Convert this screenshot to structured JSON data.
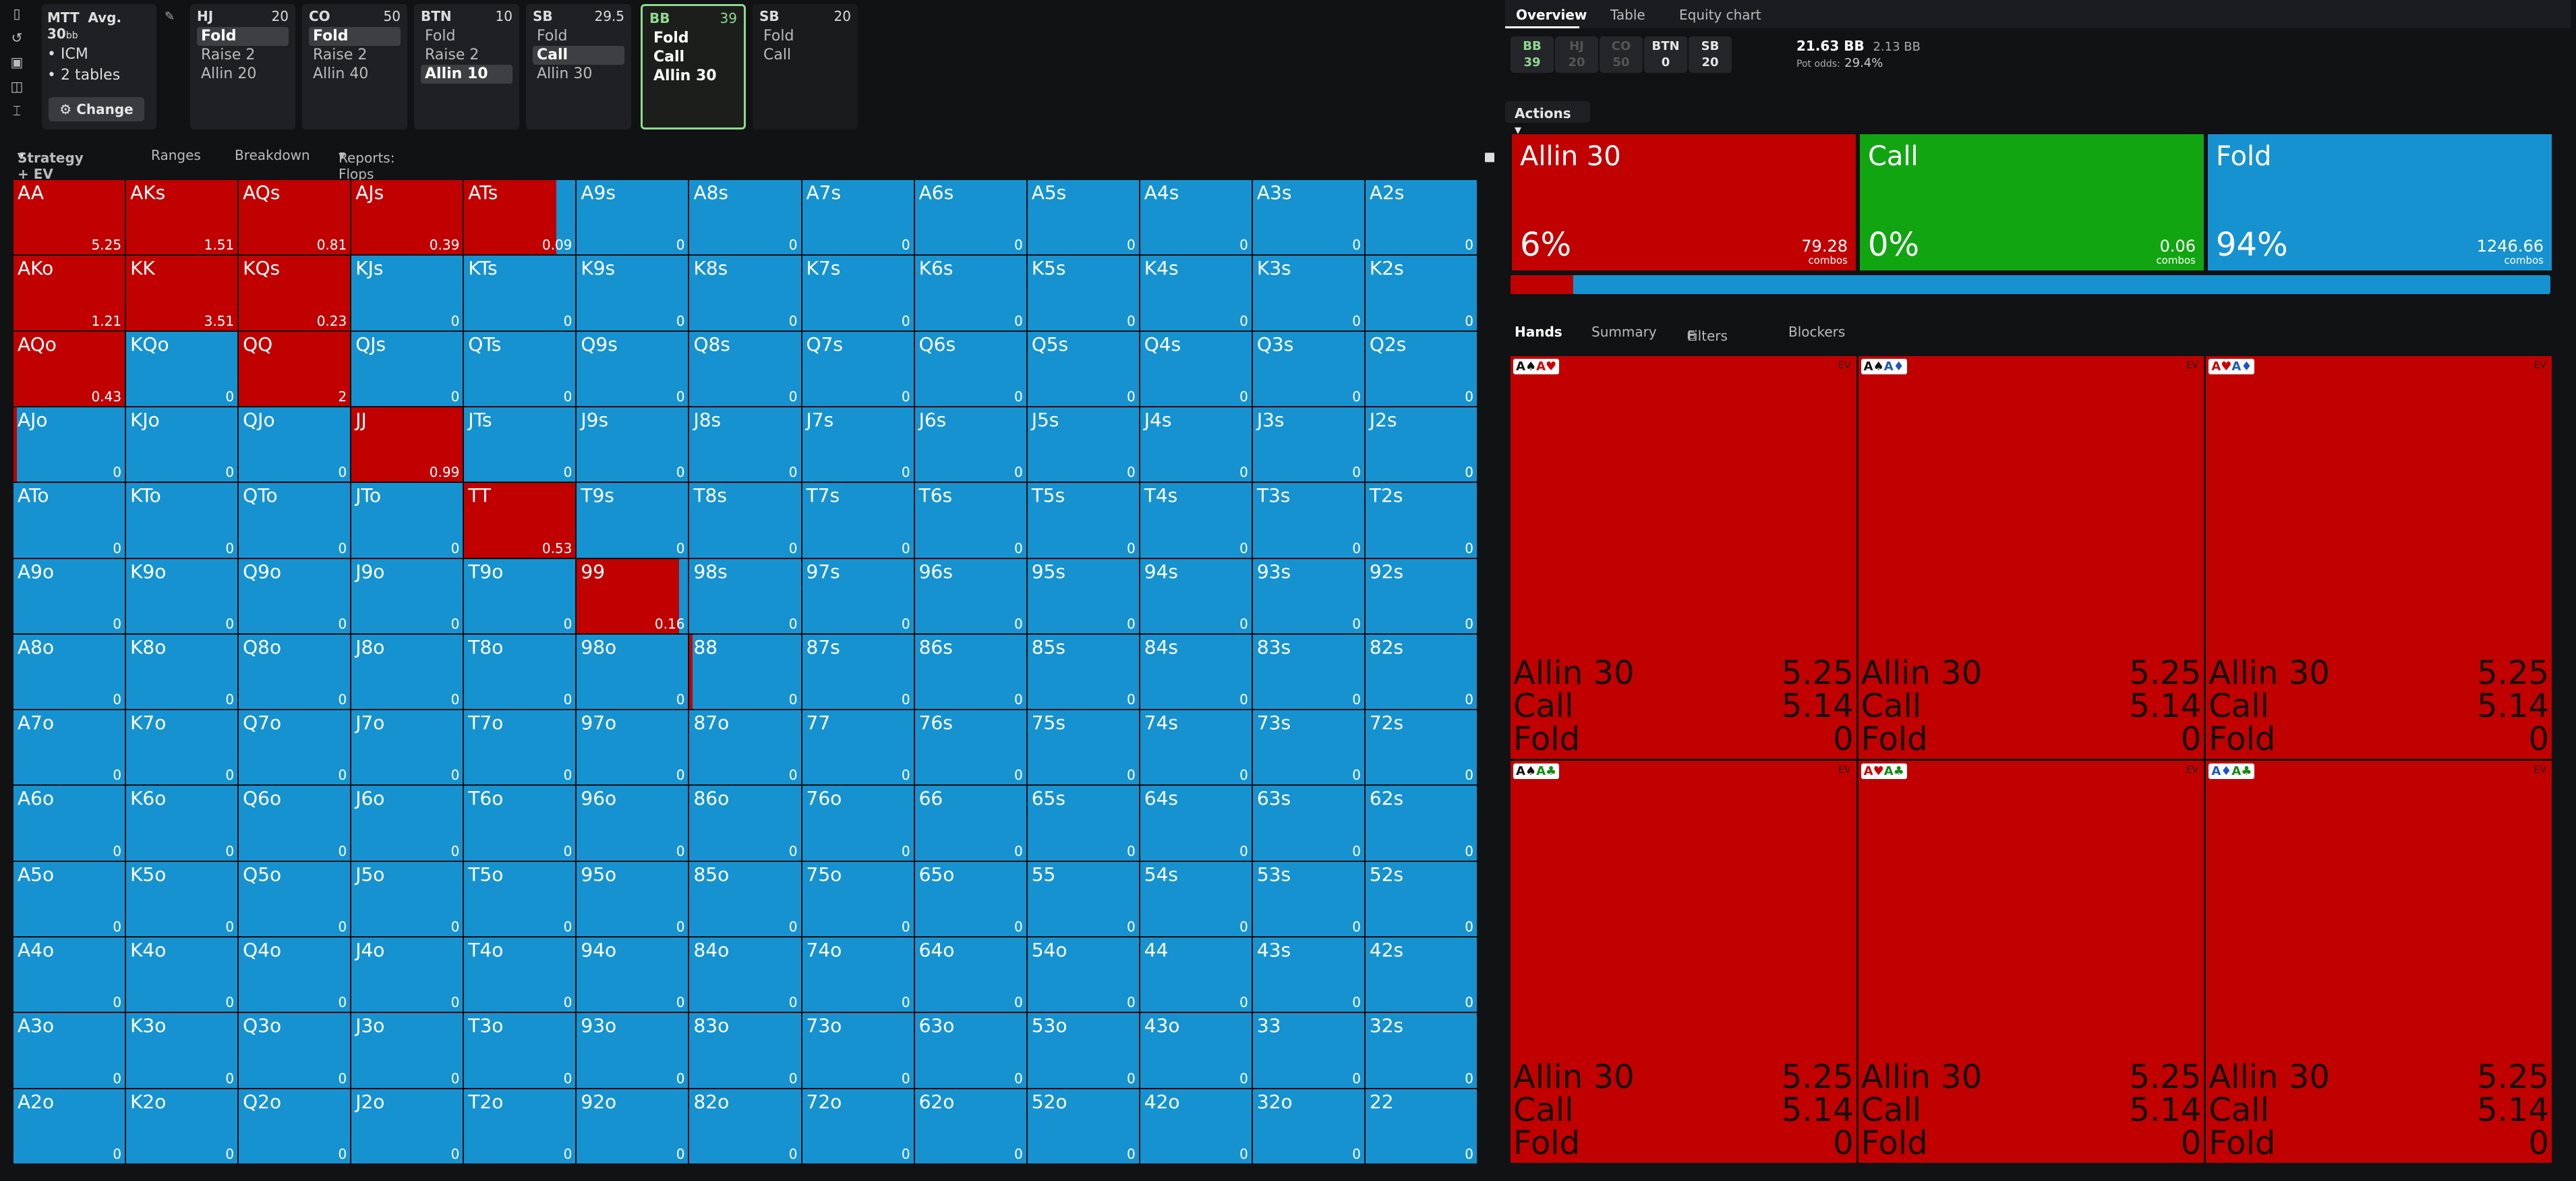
{
  "header": {
    "mtt_title": "MTT",
    "mtt_avg": "Avg. 30",
    "mtt_avg_unit": "bb",
    "mtt_items": [
      "ICM",
      "2 tables"
    ],
    "change_label": "Change",
    "positions": [
      {
        "name": "HJ",
        "stack": "20",
        "actions": [
          "Fold",
          "Raise 2",
          "Allin 20"
        ],
        "selected": 0
      },
      {
        "name": "CO",
        "stack": "50",
        "actions": [
          "Fold",
          "Raise 2",
          "Allin 40"
        ],
        "selected": 0
      },
      {
        "name": "BTN",
        "stack": "10",
        "actions": [
          "Fold",
          "Raise 2",
          "Allin 10"
        ],
        "selected": 2
      },
      {
        "name": "SB",
        "stack": "29.5",
        "actions": [
          "Fold",
          "Call",
          "Allin 30"
        ],
        "selected": 1
      },
      {
        "name": "BB",
        "stack": "39",
        "actions": [
          "Fold",
          "Call",
          "Allin 30"
        ],
        "selected": -1
      },
      {
        "name": "SB",
        "stack": "20",
        "actions": [
          "Fold",
          "Call"
        ],
        "selected": -1
      }
    ]
  },
  "left_tabs": {
    "strategy": "Strategy + EV",
    "ranges": "Ranges",
    "breakdown": "Breakdown",
    "reports": "Reports: Flops"
  },
  "grid": {
    "hands": [
      [
        "AA",
        "AKs",
        "AQs",
        "AJs",
        "ATs",
        "A9s",
        "A8s",
        "A7s",
        "A6s",
        "A5s",
        "A4s",
        "A3s",
        "A2s"
      ],
      [
        "AKo",
        "KK",
        "KQs",
        "KJs",
        "KTs",
        "K9s",
        "K8s",
        "K7s",
        "K6s",
        "K5s",
        "K4s",
        "K3s",
        "K2s"
      ],
      [
        "AQo",
        "KQo",
        "QQ",
        "QJs",
        "QTs",
        "Q9s",
        "Q8s",
        "Q7s",
        "Q6s",
        "Q5s",
        "Q4s",
        "Q3s",
        "Q2s"
      ],
      [
        "AJo",
        "KJo",
        "QJo",
        "JJ",
        "JTs",
        "J9s",
        "J8s",
        "J7s",
        "J6s",
        "J5s",
        "J4s",
        "J3s",
        "J2s"
      ],
      [
        "ATo",
        "KTo",
        "QTo",
        "JTo",
        "TT",
        "T9s",
        "T8s",
        "T7s",
        "T6s",
        "T5s",
        "T4s",
        "T3s",
        "T2s"
      ],
      [
        "A9o",
        "K9o",
        "Q9o",
        "J9o",
        "T9o",
        "99",
        "98s",
        "97s",
        "96s",
        "95s",
        "94s",
        "93s",
        "92s"
      ],
      [
        "A8o",
        "K8o",
        "Q8o",
        "J8o",
        "T8o",
        "98o",
        "88",
        "87s",
        "86s",
        "85s",
        "84s",
        "83s",
        "82s"
      ],
      [
        "A7o",
        "K7o",
        "Q7o",
        "J7o",
        "T7o",
        "97o",
        "87o",
        "77",
        "76s",
        "75s",
        "74s",
        "73s",
        "72s"
      ],
      [
        "A6o",
        "K6o",
        "Q6o",
        "J6o",
        "T6o",
        "96o",
        "86o",
        "76o",
        "66",
        "65s",
        "64s",
        "63s",
        "62s"
      ],
      [
        "A5o",
        "K5o",
        "Q5o",
        "J5o",
        "T5o",
        "95o",
        "85o",
        "75o",
        "65o",
        "55",
        "54s",
        "53s",
        "52s"
      ],
      [
        "A4o",
        "K4o",
        "Q4o",
        "J4o",
        "T4o",
        "94o",
        "84o",
        "74o",
        "64o",
        "54o",
        "44",
        "43s",
        "42s"
      ],
      [
        "A3o",
        "K3o",
        "Q3o",
        "J3o",
        "T3o",
        "93o",
        "83o",
        "73o",
        "63o",
        "53o",
        "43o",
        "33",
        "32s"
      ],
      [
        "A2o",
        "K2o",
        "Q2o",
        "J2o",
        "T2o",
        "92o",
        "82o",
        "72o",
        "62o",
        "52o",
        "42o",
        "32o",
        "22"
      ]
    ],
    "ev": {
      "AA": "5.25",
      "AKs": "1.51",
      "AQs": "0.81",
      "AJs": "0.39",
      "ATs": "0.09",
      "AKo": "1.21",
      "KK": "3.51",
      "KQs": "0.23",
      "AQo": "0.43",
      "QQ": "2",
      "JJ": "0.99",
      "TT": "0.53",
      "99": "0.16"
    },
    "allin_fraction": {
      "AA": 1,
      "AKs": 1,
      "AQs": 1,
      "AJs": 1,
      "ATs": 0.83,
      "AKo": 1,
      "KK": 1,
      "KQs": 1,
      "AQo": 1,
      "QQ": 1,
      "AJo": 0.03,
      "JJ": 1,
      "TT": 1,
      "99": 0.92,
      "88": 0.03
    },
    "default_ev": "0",
    "colors": {
      "allin": "#c10000",
      "fold": "#1692d0"
    }
  },
  "right_tabs": {
    "overview": "Overview",
    "table": "Table",
    "equity": "Equity chart"
  },
  "stacks": [
    {
      "pos": "BB",
      "val": "39",
      "style": "g"
    },
    {
      "pos": "HJ",
      "val": "20",
      "style": "d"
    },
    {
      "pos": "CO",
      "val": "50",
      "style": "d"
    },
    {
      "pos": "BTN",
      "val": "0",
      "style": ""
    },
    {
      "pos": "SB",
      "val": "20",
      "style": ""
    }
  ],
  "pot": {
    "size": "21.63 BB",
    "call": "2.13 BB",
    "odds_label": "Pot odds:",
    "odds": "29.4%"
  },
  "actions_label": "Actions",
  "actions": [
    {
      "label": "Allin 30",
      "pct": "6%",
      "combos": "79.28",
      "color": "#c10000"
    },
    {
      "label": "Call",
      "pct": "0%",
      "combos": "0.06",
      "color": "#12a512"
    },
    {
      "label": "Fold",
      "pct": "94%",
      "combos": "1246.66",
      "color": "#1692d0"
    }
  ],
  "combos_word": "combos",
  "frequency_bar": {
    "allin": 0.06
  },
  "bottom_tabs": {
    "hands": "Hands",
    "summary": "Summary",
    "filters": "Filters",
    "blockers": "Blockers"
  },
  "hand_combos": [
    {
      "cards": [
        [
          "A",
          "♠",
          "blk"
        ],
        [
          "A",
          "♥",
          "red"
        ]
      ],
      "ev_label": "EV"
    },
    {
      "cards": [
        [
          "A",
          "♠",
          "blk"
        ],
        [
          "A",
          "♦",
          "blu"
        ]
      ],
      "ev_label": "EV"
    },
    {
      "cards": [
        [
          "A",
          "♥",
          "red"
        ],
        [
          "A",
          "♦",
          "blu"
        ]
      ],
      "ev_label": "EV"
    },
    {
      "cards": [
        [
          "A",
          "♠",
          "blk"
        ],
        [
          "A",
          "♣",
          "grn"
        ]
      ],
      "ev_label": "EV"
    },
    {
      "cards": [
        [
          "A",
          "♥",
          "red"
        ],
        [
          "A",
          "♣",
          "grn"
        ]
      ],
      "ev_label": "EV"
    },
    {
      "cards": [
        [
          "A",
          "♦",
          "blu"
        ],
        [
          "A",
          "♣",
          "grn"
        ]
      ],
      "ev_label": "EV"
    }
  ],
  "hand_rows": [
    [
      "Allin 30",
      "5.25"
    ],
    [
      "Call",
      "5.14"
    ],
    [
      "Fold",
      "0"
    ]
  ]
}
